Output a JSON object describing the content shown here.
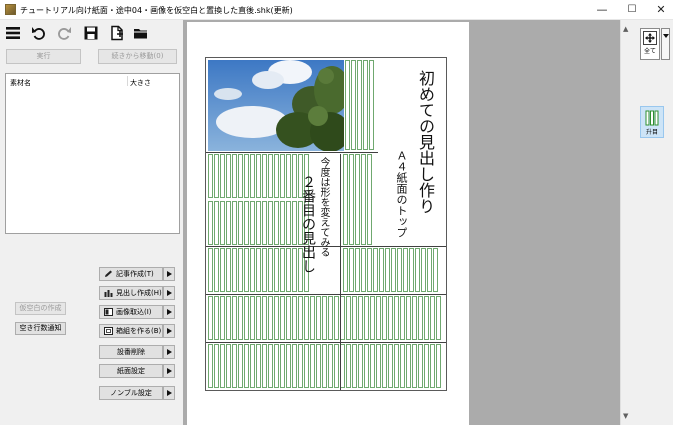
{
  "window": {
    "title": "チュートリアル向け紙面・途中04・画像を仮空白と置換した直後.shk(更新)",
    "minimize": "—",
    "maximize": "☐",
    "close": "✕"
  },
  "toolbar": {
    "icons": [
      "menu-icon",
      "undo-icon",
      "redo-icon",
      "save-icon",
      "new-file-icon",
      "open-folder-icon"
    ]
  },
  "left_panel": {
    "execute_label": "実行",
    "continue_label": "続きから移動(0)",
    "material_list": {
      "columns": [
        "素材名",
        "大きさ"
      ]
    },
    "commands": [
      {
        "label": "記事作成(T)",
        "icon": "pencil-icon"
      },
      {
        "label": "見出し作成(H)",
        "icon": "bar-chart-icon"
      },
      {
        "label": "画像取込(I)",
        "icon": "image-icon"
      },
      {
        "label": "箱組を作る(B)",
        "icon": "box-icon"
      },
      {
        "label": "設番削除"
      },
      {
        "label": "紙面設定"
      },
      {
        "label": "ノンブル設定"
      }
    ],
    "temp_blank_label": "仮空白の作成",
    "notify_label": "空き行数通知"
  },
  "paper": {
    "main_headline": "初めての見出し作り",
    "main_subhead": "Ａ４紙面のトップ",
    "second_headline": "２番目の見出し",
    "second_subhead": "今度は形を変えてみる"
  },
  "right_panel": {
    "view_all_label": "全て",
    "masu_label": "升目"
  },
  "colors": {
    "grid_green": "#6fa86f",
    "selected_blue": "#cde4f7"
  }
}
